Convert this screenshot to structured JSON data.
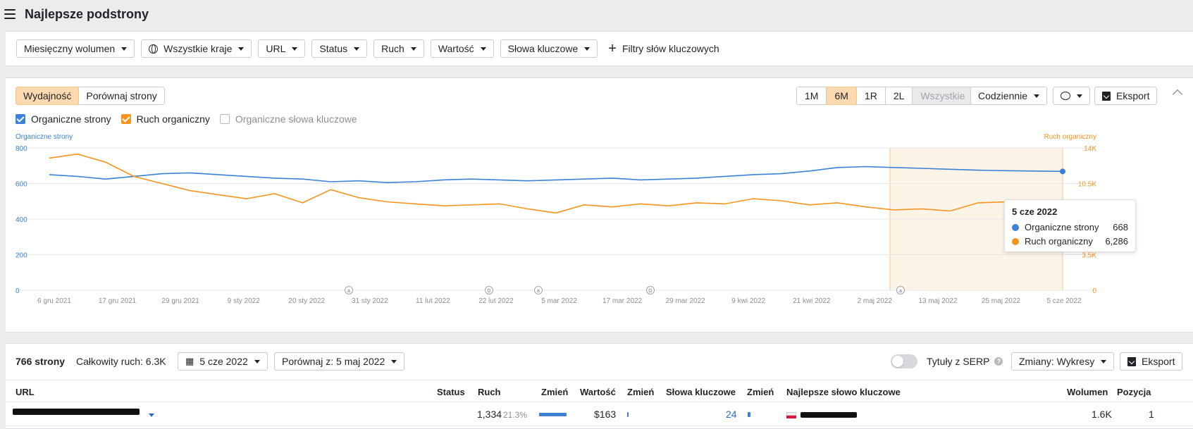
{
  "header": {
    "title": "Najlepsze podstrony"
  },
  "filters": {
    "volume": "Miesięczny wolumen",
    "countries": "Wszystkie kraje",
    "url": "URL",
    "status": "Status",
    "traffic": "Ruch",
    "value": "Wartość",
    "keywords": "Słowa kluczowe",
    "keyword_filters": "Filtry słów kluczowych"
  },
  "chart_panel": {
    "tab_performance": "Wydajność",
    "tab_compare": "Porównaj strony",
    "ranges": [
      "1M",
      "6M",
      "1R",
      "2L",
      "Wszystkie"
    ],
    "active_range": "6M",
    "interval": "Codziennie",
    "export": "Eksport",
    "legend": {
      "organic_pages": "Organiczne strony",
      "organic_traffic": "Ruch organiczny",
      "organic_keywords": "Organiczne słowa kluczowe"
    }
  },
  "chart_data": {
    "type": "line",
    "left_axis_label": "Organiczne strony",
    "right_axis_label": "Ruch organiczny",
    "left_ticks": [
      "0",
      "200",
      "400",
      "600",
      "800"
    ],
    "right_ticks": [
      "0",
      "3.5K",
      "7K",
      "10.5K",
      "14K"
    ],
    "left_ylim": [
      0,
      800
    ],
    "right_ylim": [
      0,
      14000
    ],
    "x_ticks": [
      "6 gru 2021",
      "17 gru 2021",
      "29 gru 2021",
      "9 sty 2022",
      "20 sty 2022",
      "31 sty 2022",
      "11 lut 2022",
      "22 lut 2022",
      "5 mar 2022",
      "17 mar 2022",
      "29 mar 2022",
      "9 kwi 2022",
      "21 kwi 2022",
      "2 maj 2022",
      "13 maj 2022",
      "25 maj 2022",
      "5 cze 2022"
    ],
    "markers": [
      "a",
      "G",
      "a",
      "G",
      "a"
    ],
    "series": [
      {
        "name": "Organiczne strony",
        "color": "#3b82d6",
        "axis": "left",
        "values": [
          650,
          640,
          625,
          640,
          655,
          660,
          650,
          640,
          630,
          625,
          610,
          615,
          605,
          610,
          620,
          625,
          620,
          615,
          620,
          625,
          630,
          620,
          625,
          630,
          640,
          650,
          655,
          670,
          690,
          695,
          690,
          685,
          680,
          675,
          672,
          670,
          668
        ]
      },
      {
        "name": "Ruch organiczny",
        "color": "#f7941d",
        "axis": "right",
        "values": [
          13000,
          13400,
          12600,
          11200,
          10500,
          9800,
          9400,
          9000,
          9500,
          8600,
          9900,
          9100,
          8700,
          8500,
          8300,
          8400,
          8500,
          8000,
          7600,
          8400,
          8200,
          8500,
          8300,
          8600,
          8500,
          9000,
          8800,
          8400,
          8600,
          8200,
          7900,
          8000,
          7800,
          8600,
          8700,
          7600,
          6286
        ]
      }
    ]
  },
  "tooltip": {
    "date": "5 cze 2022",
    "pages_label": "Organiczne strony",
    "pages_value": "668",
    "traffic_label": "Ruch organiczny",
    "traffic_value": "6,286"
  },
  "table": {
    "pages_count": "766 strony",
    "total_traffic": "Całkowity ruch: 6.3K",
    "date": "5 cze 2022",
    "compare": "Porównaj z: 5 maj 2022",
    "serp_titles": "Tytuły z SERP",
    "changes": "Zmiany: Wykresy",
    "export": "Eksport",
    "columns": [
      "URL",
      "Status",
      "Ruch",
      "Zmień",
      "Wartość",
      "Zmień",
      "Słowa kluczowe",
      "Zmień",
      "Najlepsze słowo kluczowe",
      "Wolumen",
      "Pozycja"
    ],
    "rows": [
      {
        "traffic": "1,334",
        "traffic_share": "21.3%",
        "value": "$163",
        "keywords": "24",
        "volume": "1.6K",
        "position": "1"
      }
    ]
  }
}
